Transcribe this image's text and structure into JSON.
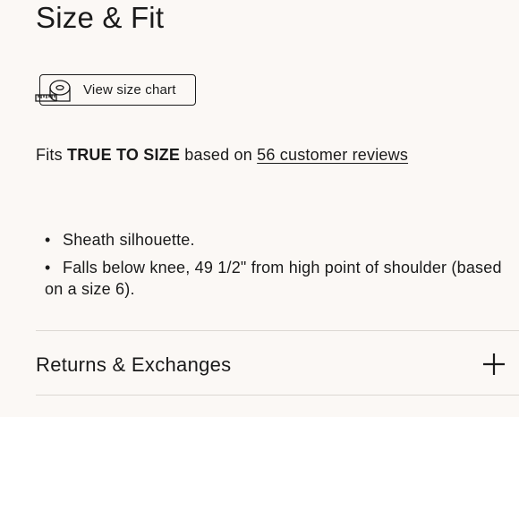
{
  "section": {
    "title": "Size & Fit"
  },
  "size_chart_button": {
    "label": "View size chart",
    "icon": "measuring-tape-icon"
  },
  "fit": {
    "prefix": "Fits",
    "verdict": "TRUE TO SIZE",
    "middle": "based on",
    "reviews_link": "56 customer reviews"
  },
  "details": [
    "Sheath silhouette.",
    "Falls below knee, 49 1/2\" from high point of shoulder (based on a size 6)."
  ],
  "accordion": {
    "label": "Returns & Exchanges",
    "icon": "plus-icon"
  },
  "colors": {
    "panel_background": "#fbf8f5",
    "text": "#1a1a1a",
    "divider": "#dcd8d3"
  }
}
